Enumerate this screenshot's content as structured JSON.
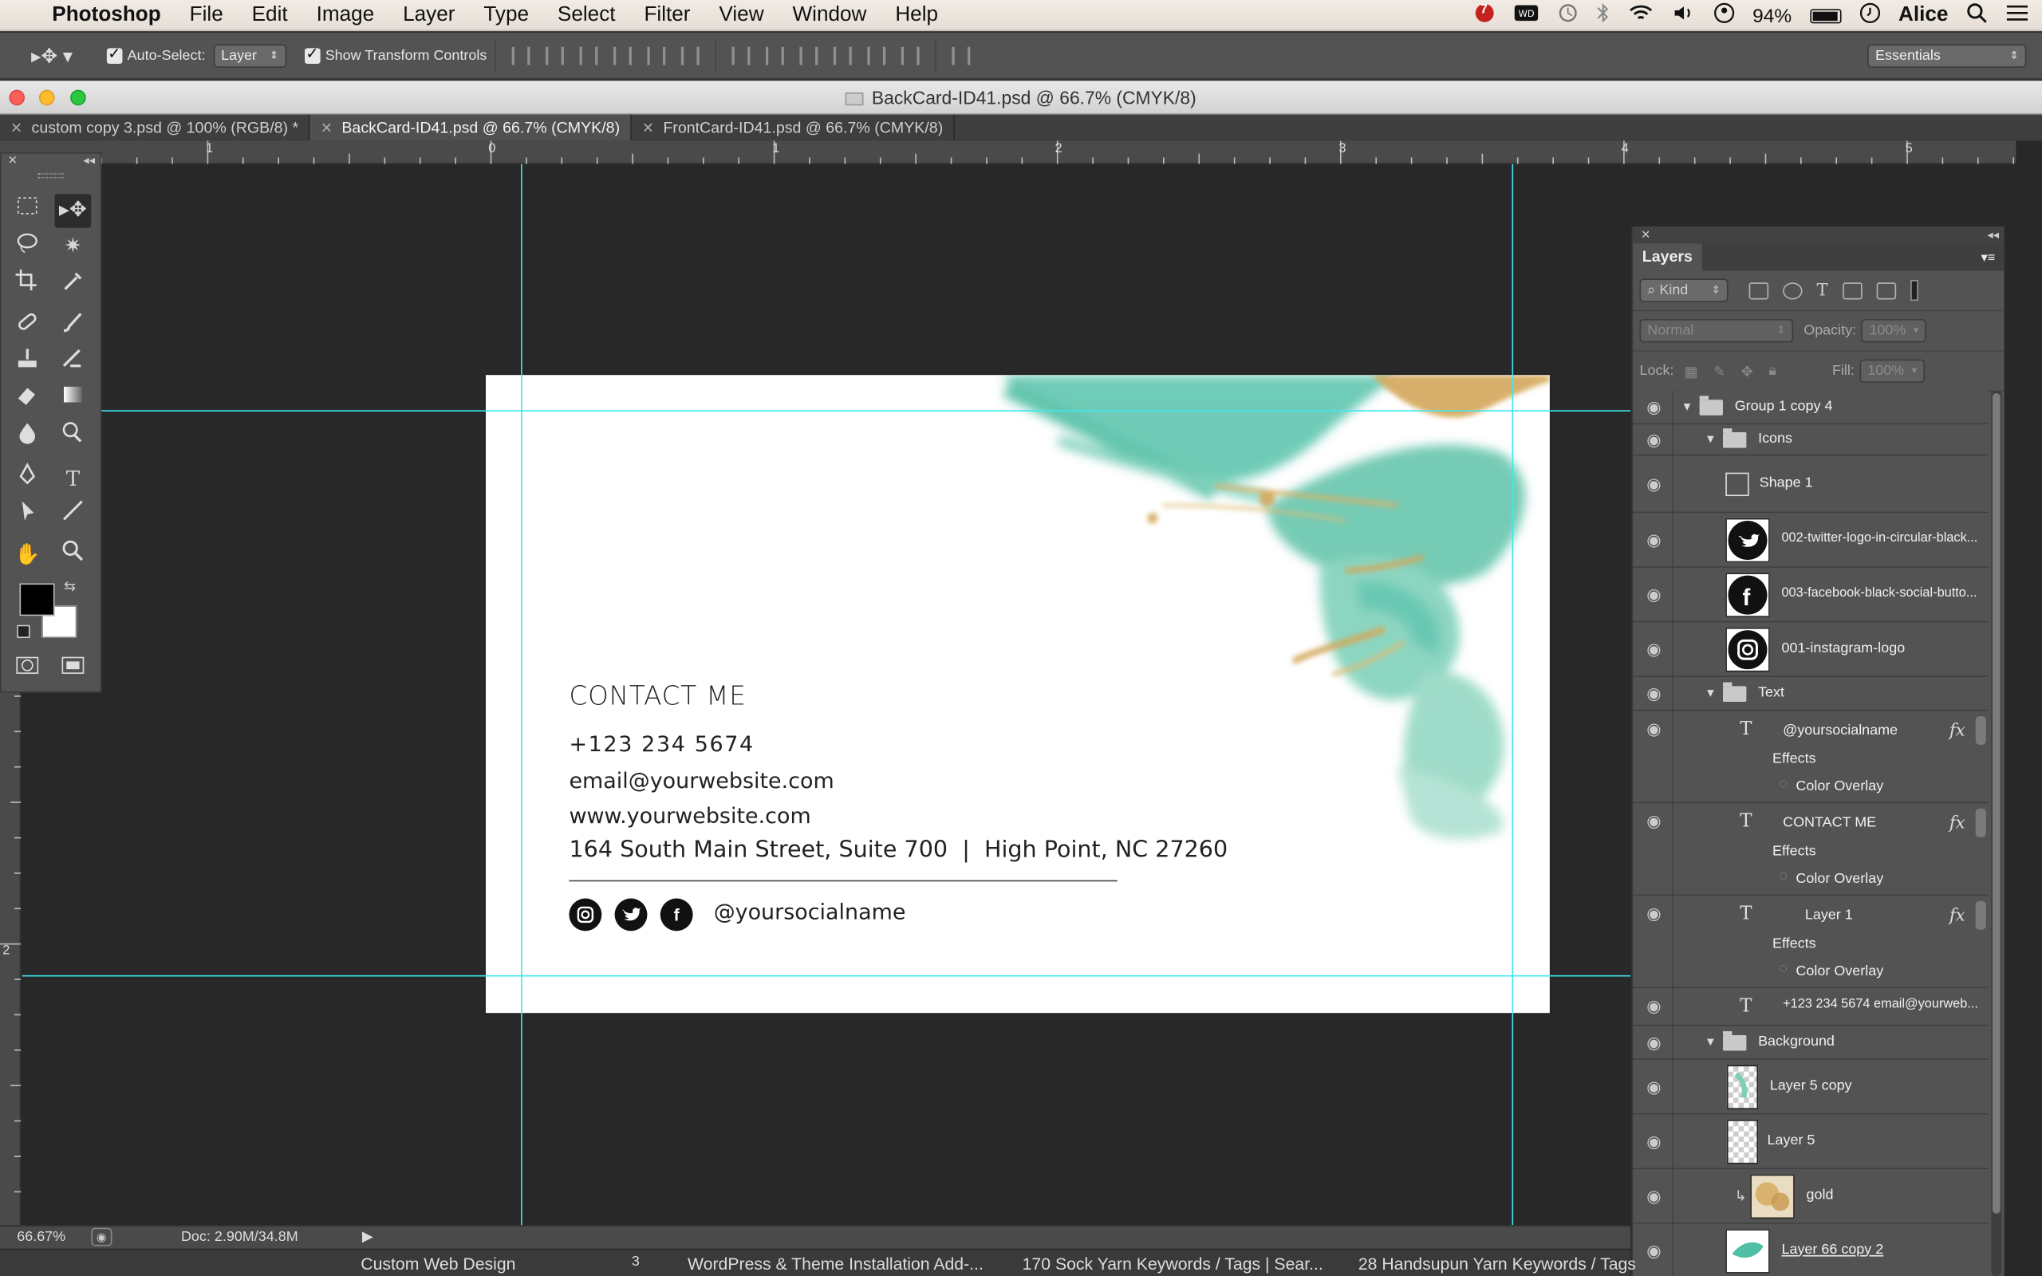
{
  "menubar": {
    "app": "Photoshop",
    "items": [
      "File",
      "Edit",
      "Image",
      "Layer",
      "Type",
      "Select",
      "Filter",
      "View",
      "Window",
      "Help"
    ],
    "battery": "94%",
    "user": "Alice",
    "notif_badge": "7"
  },
  "options": {
    "auto_select_label": "Auto-Select:",
    "auto_select_value": "Layer",
    "transform_label": "Show Transform Controls",
    "workspace": "Essentials"
  },
  "window": {
    "title": "BackCard-ID41.psd @ 66.7% (CMYK/8)"
  },
  "tabs": [
    {
      "label": "custom copy 3.psd @ 100% (RGB/8) *"
    },
    {
      "label": "BackCard-ID41.psd @ 66.7% (CMYK/8)"
    },
    {
      "label": "FrontCard-ID41.psd @ 66.7% (CMYK/8)"
    }
  ],
  "ruler": {
    "h_labels": [
      "1",
      "0",
      "1",
      "2",
      "3",
      "4",
      "5"
    ],
    "v_label": "2"
  },
  "card": {
    "heading": "CONTACT ME",
    "phone": "+123 234 5674",
    "email": "email@yourwebsite.com",
    "website": "www.yourwebsite.com",
    "address": "164 South Main Street, Suite 700  |  High Point, NC 27260",
    "social_handle": "@yoursocialname",
    "social_icons": [
      "instagram-icon",
      "twitter-icon",
      "facebook-icon"
    ]
  },
  "layers_panel": {
    "title": "Layers",
    "filter_kind": "Kind",
    "blend_mode": "Normal",
    "opacity_label": "Opacity:",
    "opacity_value": "100%",
    "lock_label": "Lock:",
    "fill_label": "Fill:",
    "fill_value": "100%",
    "effects_label": "Effects",
    "color_overlay_label": "Color Overlay",
    "layers": {
      "group": "Group 1 copy 4",
      "icons_folder": "Icons",
      "shape1": "Shape 1",
      "twitter": "002-twitter-logo-in-circular-black...",
      "facebook": "003-facebook-black-social-butto...",
      "instagram": "001-instagram-logo",
      "text_folder": "Text",
      "t_social": "@yoursocialname",
      "t_contact": "CONTACT ME",
      "t_layer1": "Layer 1",
      "t_info": "+123 234 5674 email@yourweb...",
      "bg_folder": "Background",
      "layer5copy": "Layer 5 copy",
      "layer5": "Layer 5",
      "gold": "gold",
      "layer66": "Layer 66 copy 2"
    }
  },
  "status": {
    "zoom": "66.67%",
    "doc": "Doc: 2.90M/34.8M"
  },
  "taskbar": {
    "items": [
      "Custom Web Design",
      "3",
      "WordPress & Theme Installation Add-...",
      "170 Sock Yarn Keywords / Tags | Sear...",
      "28 Handsupun Yarn Keywords / Tags"
    ]
  },
  "colors": {
    "guide": "#3fe7ef",
    "teal": "#4fbfa6",
    "gold": "#d4a75a"
  }
}
